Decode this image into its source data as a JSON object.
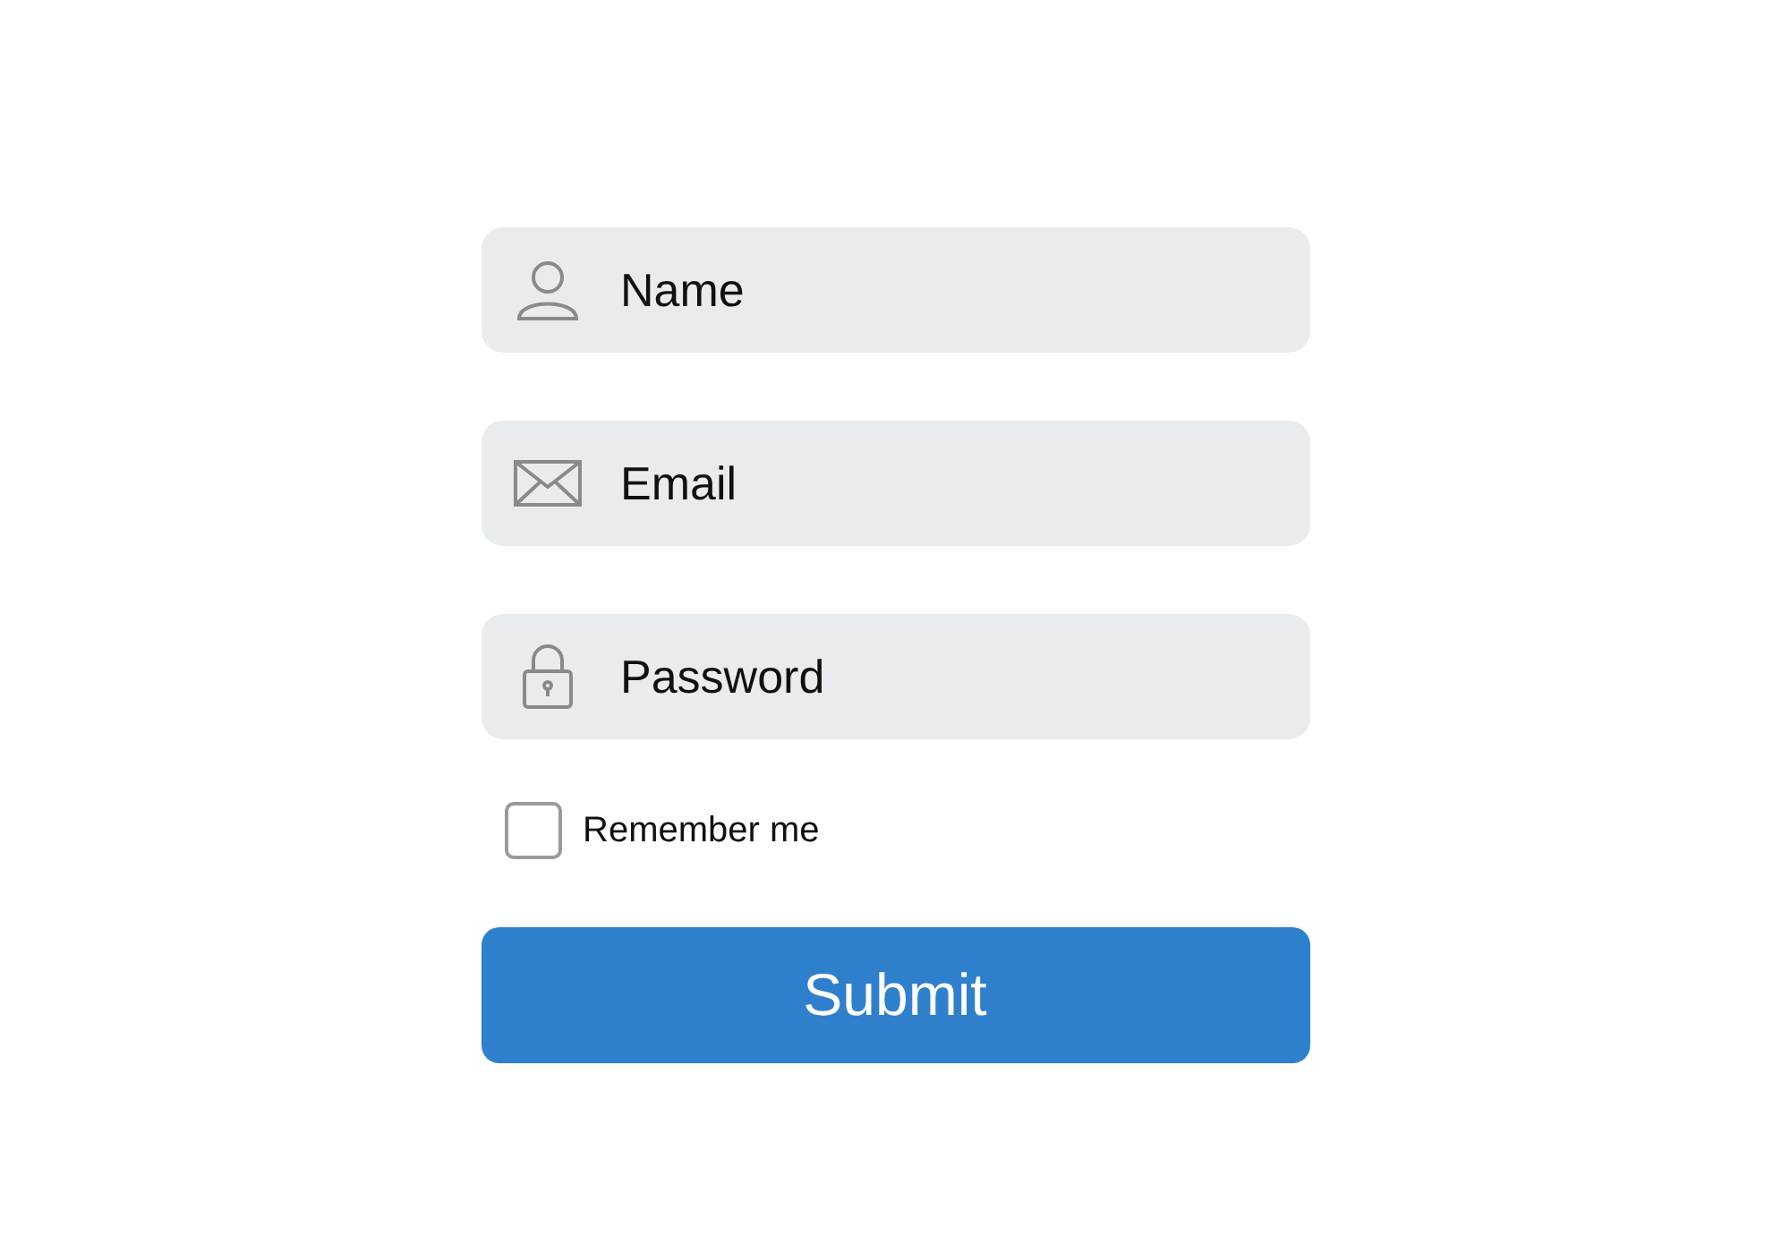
{
  "fields": [
    {
      "kind": "person",
      "placeholder": "Name"
    },
    {
      "kind": "mail",
      "placeholder": "Email"
    },
    {
      "kind": "lock",
      "placeholder": "Password"
    }
  ],
  "remember": {
    "label": "Remember me",
    "checked": false
  },
  "submit": {
    "label": "Submit"
  }
}
